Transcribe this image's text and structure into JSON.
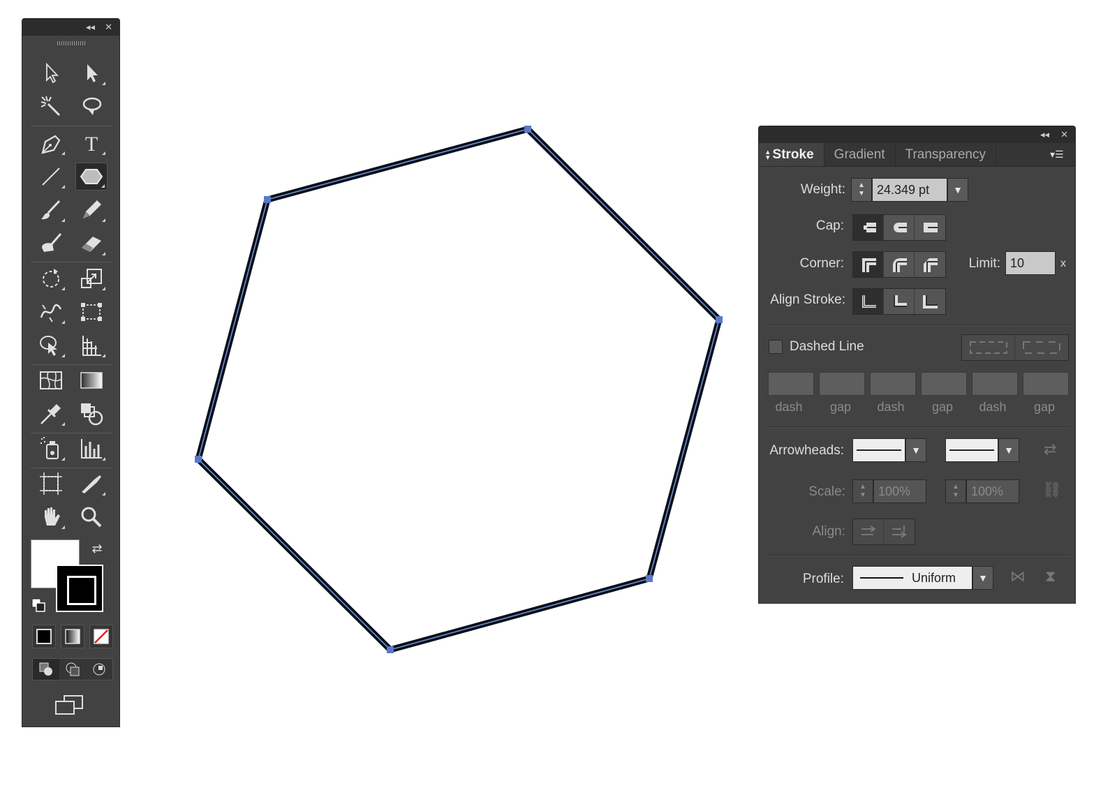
{
  "toolbar": {
    "header_icons": [
      "collapse-icon",
      "close-icon"
    ],
    "tools": [
      {
        "name": "selection-tool",
        "icon": "arrow-outline"
      },
      {
        "name": "direct-selection-tool",
        "icon": "arrow-solid"
      },
      {
        "name": "magic-wand-tool",
        "icon": "wand"
      },
      {
        "name": "lasso-tool",
        "icon": "lasso"
      },
      {
        "name": "pen-tool",
        "icon": "pen"
      },
      {
        "name": "type-tool",
        "icon": "T"
      },
      {
        "name": "line-segment-tool",
        "icon": "line"
      },
      {
        "name": "polygon-tool",
        "icon": "hexagon",
        "active": true
      },
      {
        "name": "paintbrush-tool",
        "icon": "brush"
      },
      {
        "name": "pencil-tool",
        "icon": "pencil"
      },
      {
        "name": "blob-brush-tool",
        "icon": "blob"
      },
      {
        "name": "eraser-tool",
        "icon": "eraser"
      },
      {
        "name": "rotate-tool",
        "icon": "rotate"
      },
      {
        "name": "scale-tool",
        "icon": "scale"
      },
      {
        "name": "width-tool",
        "icon": "width"
      },
      {
        "name": "free-transform-tool",
        "icon": "transform"
      },
      {
        "name": "shape-builder-tool",
        "icon": "shape-builder"
      },
      {
        "name": "perspective-grid-tool",
        "icon": "perspective"
      },
      {
        "name": "mesh-tool",
        "icon": "mesh"
      },
      {
        "name": "gradient-tool",
        "icon": "gradient"
      },
      {
        "name": "eyedropper-tool",
        "icon": "eyedropper"
      },
      {
        "name": "blend-tool",
        "icon": "blend"
      },
      {
        "name": "symbol-sprayer-tool",
        "icon": "sprayer"
      },
      {
        "name": "column-graph-tool",
        "icon": "graph"
      },
      {
        "name": "artboard-tool",
        "icon": "artboard"
      },
      {
        "name": "slice-tool",
        "icon": "slice"
      },
      {
        "name": "hand-tool",
        "icon": "hand"
      },
      {
        "name": "zoom-tool",
        "icon": "zoom"
      }
    ],
    "fill_color": "#ffffff",
    "stroke_color": "#000000"
  },
  "canvas": {
    "shape": "hexagon",
    "stroke_color": "#0a0e1a",
    "path_color": "#6f8fd6",
    "fill_color": "#ffffff"
  },
  "panel": {
    "tabs": [
      "Stroke",
      "Gradient",
      "Transparency"
    ],
    "active_tab": "Stroke",
    "weight_label": "Weight:",
    "weight_value": "24.349 pt",
    "cap_label": "Cap:",
    "corner_label": "Corner:",
    "limit_label": "Limit:",
    "limit_value": "10",
    "limit_unit": "x",
    "align_stroke_label": "Align Stroke:",
    "dashed_line_label": "Dashed Line",
    "dashed_line_checked": false,
    "dash_labels": [
      "dash",
      "gap",
      "dash",
      "gap",
      "dash",
      "gap"
    ],
    "arrowheads_label": "Arrowheads:",
    "scale_label": "Scale:",
    "scale_start": "100%",
    "scale_end": "100%",
    "align_label": "Align:",
    "profile_label": "Profile:",
    "profile_value": "Uniform"
  }
}
